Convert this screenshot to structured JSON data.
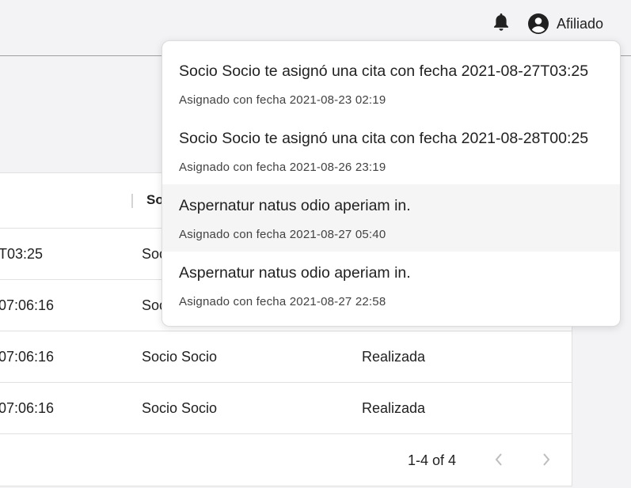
{
  "header": {
    "notifications_icon": "bell-icon",
    "user_icon": "account-circle-icon",
    "user_label": "Afiliado"
  },
  "table": {
    "header_visible": "So",
    "rows": [
      {
        "col1": "T03:25",
        "col2": "Soc",
        "col3": ""
      },
      {
        "col1": "07:06:16",
        "col2": "Soc",
        "col3": ""
      },
      {
        "col1": "07:06:16",
        "col2": "Socio Socio",
        "col3": "Realizada"
      },
      {
        "col1": "07:06:16",
        "col2": "Socio Socio",
        "col3": "Realizada"
      }
    ],
    "pagination": {
      "range": "1-4 of 4",
      "prev_icon": "chevron-left-icon",
      "next_icon": "chevron-right-icon"
    }
  },
  "notifications": [
    {
      "message": "Socio Socio te asignó una cita con fecha 2021-08-27T03:25",
      "date": "Asignado con fecha 2021-08-23 02:19"
    },
    {
      "message": "Socio Socio te asignó una cita con fecha 2021-08-28T00:25",
      "date": "Asignado con fecha 2021-08-26 23:19"
    },
    {
      "message": "Aspernatur natus odio aperiam in.",
      "date": "Asignado con fecha 2021-08-27 05:40"
    },
    {
      "message": "Aspernatur natus odio aperiam in.",
      "date": "Asignado con fecha 2021-08-27 22:58"
    }
  ],
  "colors": {
    "background": "#f3f3f5",
    "surface": "#ffffff",
    "hover": "#f5f5f5",
    "text": "#212121",
    "icon": "#212121"
  }
}
